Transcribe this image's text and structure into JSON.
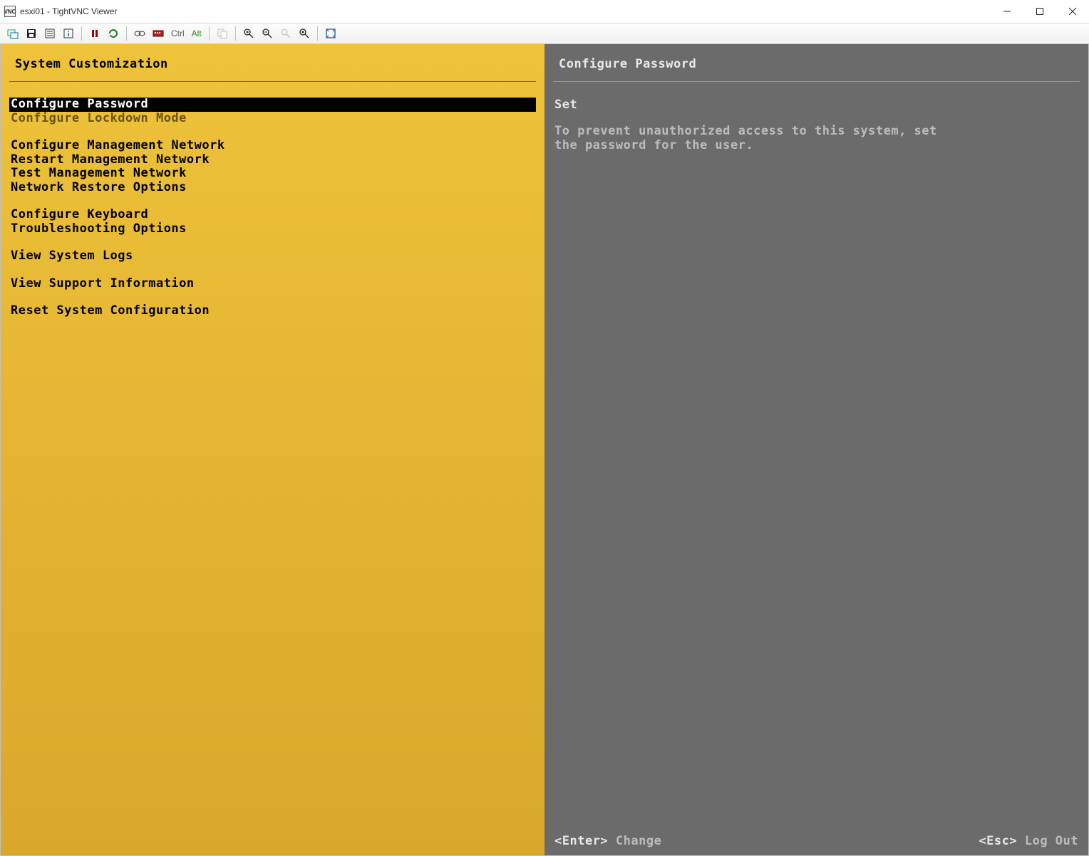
{
  "window": {
    "title": "esxi01 - TightVNC Viewer",
    "app_icon_text": "VNC"
  },
  "toolbar": {
    "ctrl_label": "Ctrl",
    "alt_label": "Alt"
  },
  "left": {
    "header": "System Customization",
    "groups": [
      {
        "items": [
          {
            "label": "Configure Password",
            "state": "selected"
          },
          {
            "label": "Configure Lockdown Mode",
            "state": "dim"
          }
        ]
      },
      {
        "items": [
          {
            "label": "Configure Management Network",
            "state": ""
          },
          {
            "label": "Restart Management Network",
            "state": ""
          },
          {
            "label": "Test Management Network",
            "state": ""
          },
          {
            "label": "Network Restore Options",
            "state": ""
          }
        ]
      },
      {
        "items": [
          {
            "label": "Configure Keyboard",
            "state": ""
          },
          {
            "label": "Troubleshooting Options",
            "state": ""
          }
        ]
      },
      {
        "items": [
          {
            "label": "View System Logs",
            "state": ""
          }
        ]
      },
      {
        "items": [
          {
            "label": "View Support Information",
            "state": ""
          }
        ]
      },
      {
        "items": [
          {
            "label": "Reset System Configuration",
            "state": ""
          }
        ]
      }
    ]
  },
  "right": {
    "header": "Configure Password",
    "status": "Set",
    "description": "To prevent unauthorized access to this system, set the password for the user."
  },
  "footer": {
    "enter_key": "<Enter>",
    "enter_action": "Change",
    "esc_key": "<Esc>",
    "esc_action": "Log Out"
  }
}
